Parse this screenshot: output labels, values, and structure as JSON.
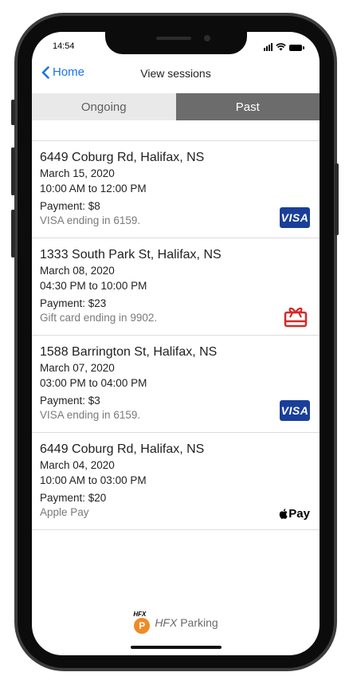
{
  "status": {
    "time": "14:54"
  },
  "nav": {
    "back_label": "Home",
    "title": "View sessions"
  },
  "tabs": [
    {
      "label": "Ongoing",
      "active": false
    },
    {
      "label": "Past",
      "active": true
    }
  ],
  "sessions": [
    {
      "address": "6449 Coburg Rd, Halifax, NS",
      "date": "March 15, 2020",
      "time": "10:00 AM to 12:00 PM",
      "payment": "Payment: $8",
      "method": "VISA ending in 6159.",
      "icon": "visa-icon",
      "icon_text": "VISA"
    },
    {
      "address": "1333 South Park St, Halifax, NS",
      "date": "March 08, 2020",
      "time": "04:30 PM to 10:00 PM",
      "payment": "Payment: $23",
      "method": "Gift card ending in 9902.",
      "icon": "gift-card-icon",
      "icon_text": ""
    },
    {
      "address": "1588 Barrington St, Halifax, NS",
      "date": "March 07, 2020",
      "time": "03:00 PM to 04:00 PM",
      "payment": "Payment: $3",
      "method": "VISA ending in 6159.",
      "icon": "visa-icon",
      "icon_text": "VISA"
    },
    {
      "address": "6449 Coburg Rd, Halifax, NS",
      "date": "March 04, 2020",
      "time": "10:00 AM to 03:00 PM",
      "payment": "Payment: $20",
      "method": "Apple Pay",
      "icon": "apple-pay-icon",
      "icon_text": "Pay"
    }
  ],
  "footer": {
    "logo_top": "HFX",
    "logo_letter": "P",
    "brand_italic": "HFX",
    "brand_rest": " Parking"
  },
  "colors": {
    "accent": "#1a73e8",
    "tab_active": "#6c6c6c",
    "tab_inactive": "#e9e9e9",
    "visa": "#1a3f9a",
    "gift": "#d62828",
    "logo": "#f08a24"
  }
}
